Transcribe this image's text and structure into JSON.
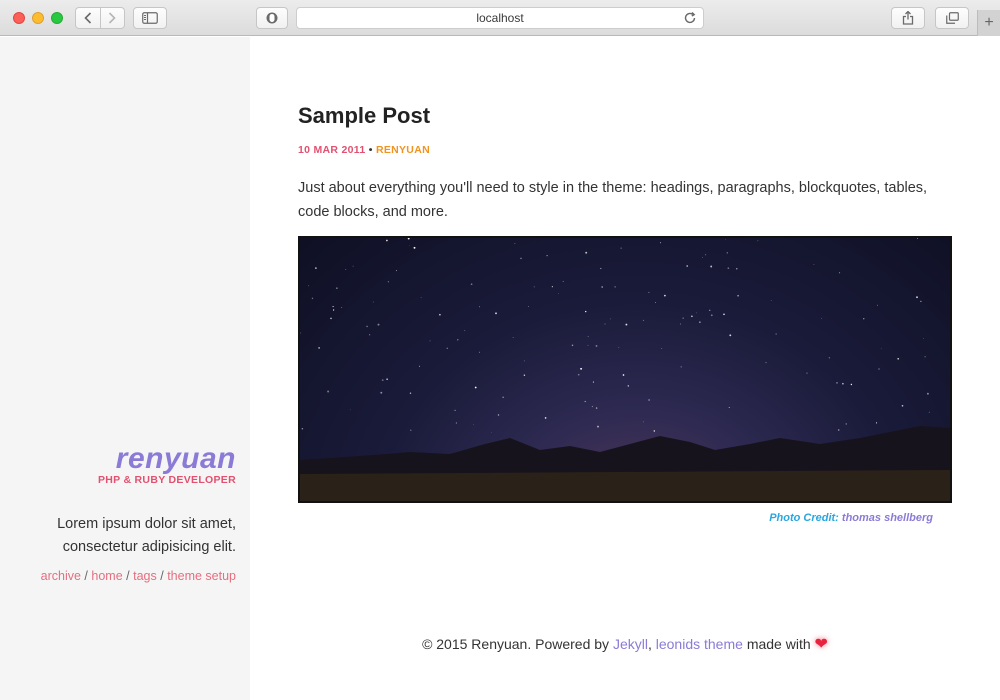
{
  "browser": {
    "address": "localhost",
    "colors": {
      "close": "#fc5f57",
      "minimize": "#fdbc2e",
      "zoom": "#28c840"
    },
    "icons": [
      "back-icon",
      "forward-icon",
      "sidebar-toggle-icon",
      "shield-icon",
      "reload-icon",
      "share-icon",
      "tabs-icon",
      "new-tab-icon"
    ]
  },
  "sidebar": {
    "name": "renyuan",
    "role": "PHP & RUBY DEVELOPER",
    "bio": "Lorem ipsum dolor sit amet, consectetur adipisicing elit.",
    "links": [
      {
        "label": "archive"
      },
      {
        "label": "home"
      },
      {
        "label": "tags"
      },
      {
        "label": "theme setup"
      }
    ],
    "separator": "/"
  },
  "post": {
    "title": "Sample Post",
    "date": "10 MAR 2011",
    "bullet": "•",
    "author": "RENYUAN",
    "description": "Just about everything you'll need to style in the theme: headings, paragraphs, blockquotes, tables, code blocks, and more.",
    "credit_label": "Photo Credit:",
    "credit_name": "thomas shellberg"
  },
  "footer": {
    "copyright": "© 2015 Renyuan. Powered by",
    "jekyll": "Jekyll",
    "comma": ",",
    "theme": "leonids theme",
    "made_with": "made with",
    "heart": "❤"
  },
  "colors": {
    "accent_purple": "#8c7bd6",
    "accent_red": "#e2516f",
    "accent_orange": "#f0941f",
    "link_pink": "#e66e7e",
    "credit_blue": "#2aa6e0",
    "sidebar_bg": "#f5f5f6"
  }
}
